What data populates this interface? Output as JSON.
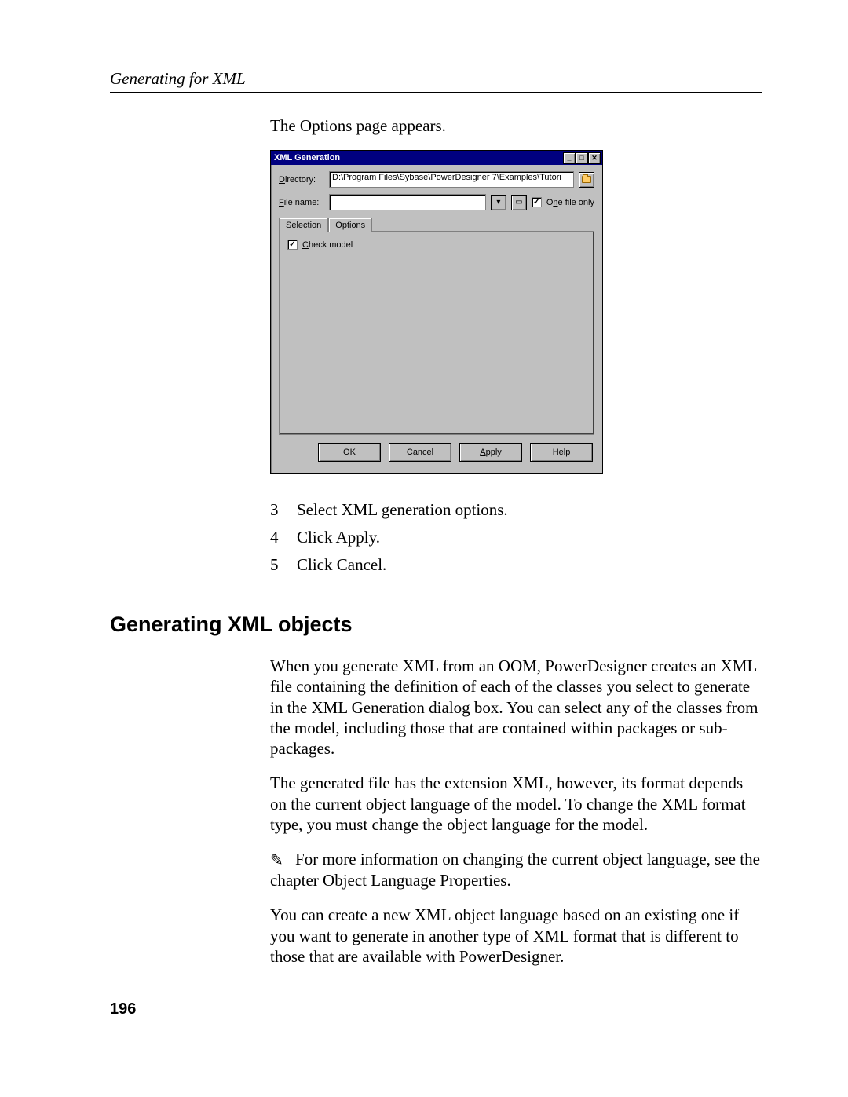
{
  "header": {
    "running_title": "Generating for XML"
  },
  "intro_line": "The Options page appears.",
  "dialog": {
    "title": "XML Generation",
    "directory_label": "Directory:",
    "directory_value": "D:\\Program Files\\Sybase\\PowerDesigner 7\\Examples\\Tutori",
    "filename_label": "File name:",
    "filename_value": "",
    "one_file_only_label": "One file only",
    "one_file_only_checked": "✓",
    "tabs": {
      "selection": "Selection",
      "options": "Options"
    },
    "check_model_label": "Check model",
    "check_model_checked": "✓",
    "buttons": {
      "ok": "OK",
      "cancel": "Cancel",
      "apply": "Apply",
      "help": "Help"
    }
  },
  "steps": [
    {
      "n": "3",
      "text": "Select XML generation options."
    },
    {
      "n": "4",
      "text": "Click Apply."
    },
    {
      "n": "5",
      "text": "Click Cancel."
    }
  ],
  "section_heading": "Generating XML objects",
  "paras": {
    "p1": "When you generate XML from an OOM, PowerDesigner creates an XML file containing the definition of each of the classes you select to generate in the XML Generation dialog box. You can select any of the classes from the model, including those that are contained within packages or sub-packages.",
    "p2": "The generated file has the extension XML, however, its format depends on the current object language of the model. To change the XML format type, you must change the object language for the model.",
    "p3_rest": "For more information on changing the current object language, see the chapter Object Language Properties.",
    "p4": "You can create a new XML object language based on an existing one if you want to generate in another type of XML format that is different to those that are available with PowerDesigner."
  },
  "page_number": "196"
}
